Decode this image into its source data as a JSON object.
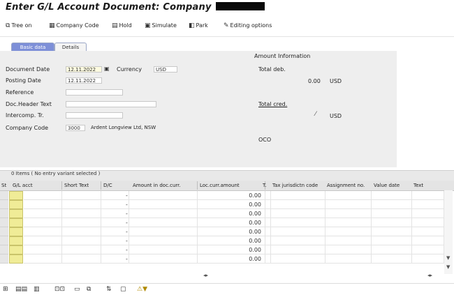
{
  "window": {
    "title": "Enter G/L Account Document: Company"
  },
  "toolbar": {
    "items": [
      {
        "icon": "tree-icon",
        "label": "Tree on"
      },
      {
        "icon": "company-code-icon",
        "label": "Company Code"
      },
      {
        "icon": "hold-icon",
        "label": "Hold"
      },
      {
        "icon": "simulate-icon",
        "label": "Simulate"
      },
      {
        "icon": "park-icon",
        "label": "Park"
      },
      {
        "icon": "editing-options-icon",
        "label": "Editing options"
      }
    ]
  },
  "tabs": {
    "basic": "Basic data",
    "details": "Details"
  },
  "form": {
    "document_date_label": "Document Date",
    "document_date_value": "12.11.2022",
    "currency_label": "Currency",
    "currency_value": "USD",
    "posting_date_label": "Posting Date",
    "posting_date_value": "12.11.2022",
    "reference_label": "Reference",
    "reference_value": "",
    "doc_header_text_label": "Doc.Header Text",
    "doc_header_text_value": "",
    "intercomp_label": "Intercomp. Tr.",
    "intercomp_value": "",
    "company_code_label": "Company Code",
    "company_code_value": "3000",
    "company_code_desc": "Ardent Longview Ltd, NSW"
  },
  "amount_info": {
    "title": "Amount Information",
    "total_deb_label": "Total deb.",
    "total_deb_value": "0.00",
    "total_deb_currency": "USD",
    "total_cred_label": "Total cred.",
    "total_cred_currency": "USD",
    "status_icon": "traffic-light-icon",
    "oco_label": "OCO"
  },
  "grid": {
    "title": "0 Items ( No entry variant selected )",
    "headers": [
      "St",
      "G/L acct",
      "Short Text",
      "D/C",
      "Amount in doc.curr.",
      "Loc.curr.amount",
      "T.",
      "Tax jurisdictn code",
      "Assignment no.",
      "Value date",
      "Text"
    ],
    "rows": [
      {
        "dc": "-",
        "loc_amt": "0.00"
      },
      {
        "dc": "-",
        "loc_amt": "0.00"
      },
      {
        "dc": "-",
        "loc_amt": "0.00"
      },
      {
        "dc": "-",
        "loc_amt": "0.00"
      },
      {
        "dc": "-",
        "loc_amt": "0.00"
      },
      {
        "dc": "-",
        "loc_amt": "0.00"
      },
      {
        "dc": "-",
        "loc_amt": "0.00"
      },
      {
        "dc": "-",
        "loc_amt": "0.00"
      }
    ]
  },
  "colors": {
    "tab_active": "#7d8fd8",
    "panel_bg": "#eeeeee",
    "required_cell": "#f0ec97"
  }
}
